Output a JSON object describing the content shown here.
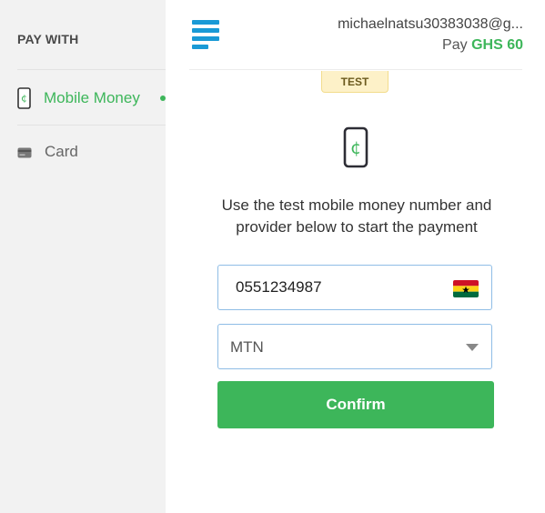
{
  "sidebar": {
    "heading": "PAY WITH",
    "items": [
      {
        "label": "Mobile Money",
        "icon": "mobile-money-icon",
        "active": true
      },
      {
        "label": "Card",
        "icon": "card-icon",
        "active": false
      }
    ]
  },
  "header": {
    "logo_icon": "paystack-logo-icon",
    "email": "michaelnatsu30383038@g...",
    "pay_label": "Pay",
    "amount": "GHS 60"
  },
  "badge": {
    "label": "TEST"
  },
  "content": {
    "icon": "mobile-money-icon",
    "instruction": "Use the test mobile money number and provider below to start the payment"
  },
  "form": {
    "phone": {
      "value": "0551234987",
      "flag_icon": "ghana-flag-icon"
    },
    "provider": {
      "selected": "MTN"
    },
    "confirm_label": "Confirm"
  },
  "colors": {
    "accent": "#3db65a",
    "sidebar_bg": "#f2f2f2",
    "badge_bg": "#fdf1c8"
  }
}
